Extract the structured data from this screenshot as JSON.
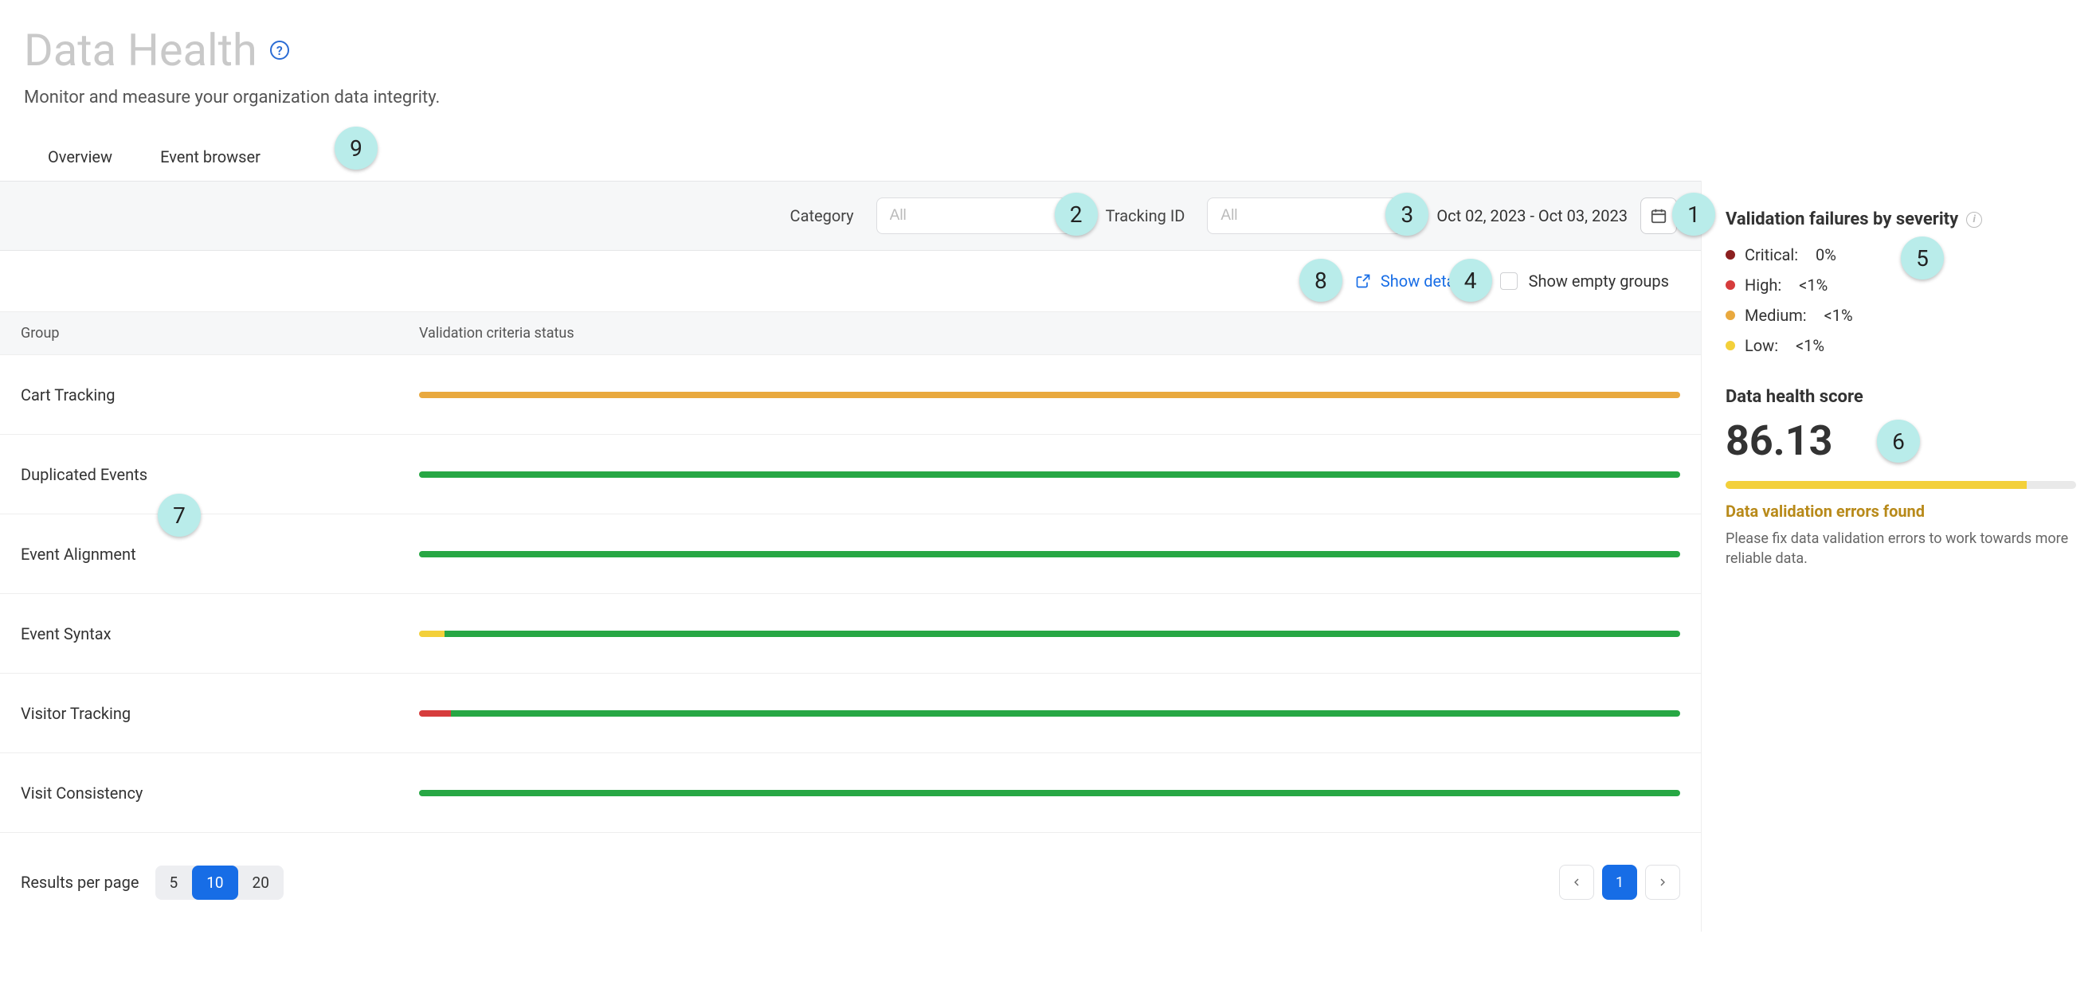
{
  "header": {
    "title": "Data Health",
    "subtitle": "Monitor and measure your organization data integrity."
  },
  "tabs": {
    "overview": "Overview",
    "event_browser": "Event browser"
  },
  "filters": {
    "category_label": "Category",
    "category_placeholder": "All",
    "tracking_label": "Tracking ID",
    "tracking_placeholder": "All",
    "date_range": "Oct 02, 2023 - Oct 03, 2023"
  },
  "toolbar": {
    "show_details": "Show details",
    "show_empty_groups": "Show empty groups"
  },
  "table": {
    "col_group": "Group",
    "col_status": "Validation criteria status",
    "rows": [
      {
        "name": "Cart Tracking",
        "segments": [
          {
            "color": "orange",
            "pct": 100
          }
        ]
      },
      {
        "name": "Duplicated Events",
        "segments": [
          {
            "color": "green",
            "pct": 100
          }
        ]
      },
      {
        "name": "Event Alignment",
        "segments": [
          {
            "color": "green",
            "pct": 100
          }
        ]
      },
      {
        "name": "Event Syntax",
        "segments": [
          {
            "color": "yellow",
            "pct": 2
          },
          {
            "color": "green",
            "pct": 98
          }
        ]
      },
      {
        "name": "Visitor Tracking",
        "segments": [
          {
            "color": "red",
            "pct": 2.5
          },
          {
            "color": "green",
            "pct": 97.5
          }
        ]
      },
      {
        "name": "Visit Consistency",
        "segments": [
          {
            "color": "green",
            "pct": 100
          }
        ]
      }
    ]
  },
  "pagination": {
    "rpp_label": "Results per page",
    "rpp_options": [
      "5",
      "10",
      "20"
    ],
    "rpp_selected": "10",
    "current_page": "1"
  },
  "severity": {
    "heading": "Validation failures by severity",
    "items": [
      {
        "label": "Critical:",
        "value": "0%",
        "color": "critical"
      },
      {
        "label": "High:",
        "value": "<1%",
        "color": "high"
      },
      {
        "label": "Medium:",
        "value": "<1%",
        "color": "medium"
      },
      {
        "label": "Low:",
        "value": "<1%",
        "color": "low"
      }
    ]
  },
  "score": {
    "heading": "Data health score",
    "value": "86.13",
    "fill_pct": 86,
    "msg_title": "Data validation errors found",
    "msg_body": "Please fix data validation errors to work towards more reliable data."
  },
  "bubbles": {
    "b1": "1",
    "b2": "2",
    "b3": "3",
    "b4": "4",
    "b5": "5",
    "b6": "6",
    "b7": "7",
    "b8": "8",
    "b9": "9"
  }
}
